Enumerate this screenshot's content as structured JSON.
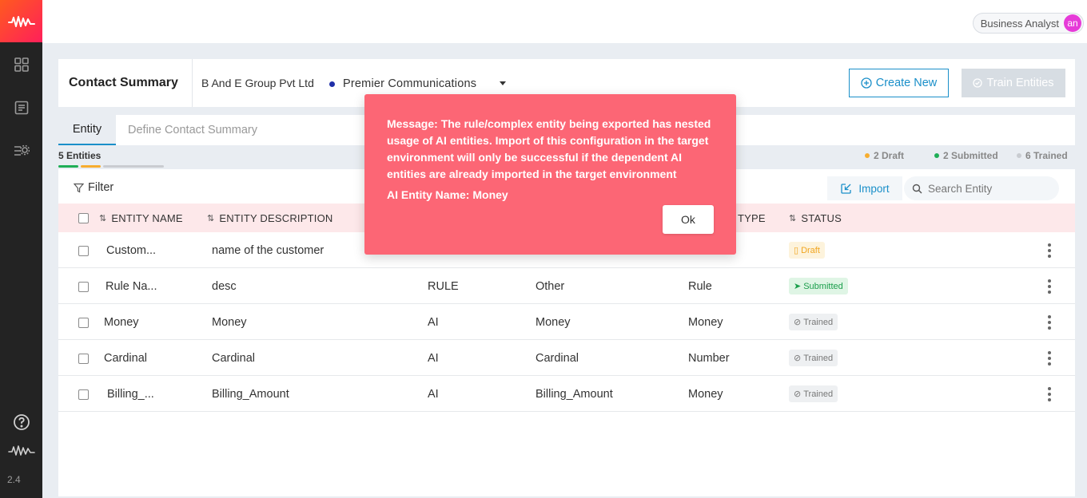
{
  "sidebar": {
    "logo_icon": "waveform-logo-icon",
    "items": [
      {
        "icon": "grid-icon"
      },
      {
        "icon": "document-icon"
      },
      {
        "icon": "settings-list-icon"
      }
    ],
    "help_icon": "help-icon",
    "version": "2.4"
  },
  "topbar": {
    "role": "Business Analyst",
    "avatar_initials": "an"
  },
  "header": {
    "title": "Contact Summary",
    "company": "B And E Group Pvt Ltd",
    "bot": "Premier Communications",
    "create_label": "Create New",
    "train_label": "Train Entities"
  },
  "tabs": [
    {
      "label": "Entity",
      "active": true
    },
    {
      "label": "Define Contact Summary",
      "active": false
    }
  ],
  "counts": {
    "entities": "5 Entities",
    "draft": "2 Draft",
    "submitted": "2 Submitted",
    "trained": "6 Trained",
    "colors": {
      "draft": "#f7ad2f",
      "submitted": "#1fae57",
      "trained": "#c9ccd1"
    }
  },
  "toolbar": {
    "filter_label": "Filter",
    "import_label": "Import",
    "search_placeholder": "Search Entity"
  },
  "table": {
    "headers": [
      "ENTITY NAME",
      "ENTITY DESCRIPTION",
      "TYPE",
      "STATUS"
    ],
    "rows": [
      {
        "name": "Custom...",
        "description": "name of the customer",
        "kind": "",
        "category": "",
        "data_type": "",
        "status": "Draft"
      },
      {
        "name": "Rule Na...",
        "description": "desc",
        "kind": "RULE",
        "category": "Other",
        "data_type": "Rule",
        "status": "Submitted"
      },
      {
        "name": "Money",
        "description": "Money",
        "kind": "AI",
        "category": "Money",
        "data_type": "Money",
        "status": "Trained"
      },
      {
        "name": "Cardinal",
        "description": "Cardinal",
        "kind": "AI",
        "category": "Cardinal",
        "data_type": "Number",
        "status": "Trained"
      },
      {
        "name": "Billing_...",
        "description": "Billing_Amount",
        "kind": "AI",
        "category": "Billing_Amount",
        "data_type": "Money",
        "status": "Trained"
      }
    ]
  },
  "modal": {
    "message": "Message: The rule/complex entity being exported has nested usage of AI entities. Import of this configuration in the target environment will only be successful if the dependent AI entities are already imported in the target environment",
    "entity_name": "AI Entity Name: Money",
    "ok_label": "Ok",
    "color": "#fc6675"
  }
}
